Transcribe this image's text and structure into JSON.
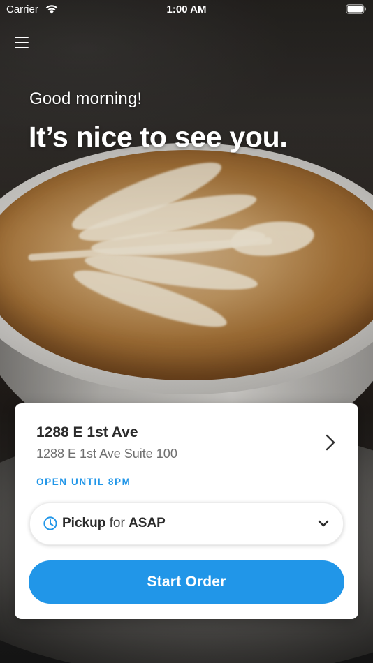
{
  "status_bar": {
    "carrier": "Carrier",
    "time": "1:00 AM",
    "wifi_icon": "wifi-icon",
    "battery_icon": "battery-icon"
  },
  "menu": {
    "icon": "hamburger-menu-icon"
  },
  "greeting": {
    "small": "Good morning!",
    "large": "It’s nice to see you."
  },
  "store_card": {
    "name": "1288 E 1st Ave",
    "address": "1288 E 1st Ave Suite 100",
    "hours": "OPEN UNTIL 8PM",
    "chevron_icon": "chevron-right-icon",
    "pickup": {
      "mode": "Pickup",
      "connector": "for",
      "time": "ASAP",
      "icon": "clock-icon",
      "dropdown_icon": "chevron-down-icon"
    },
    "start_order_label": "Start Order"
  },
  "colors": {
    "accent": "#2196E8",
    "card_background": "#FFFFFF",
    "title_text": "#2B2B2B",
    "secondary_text": "#6F6F6F"
  }
}
